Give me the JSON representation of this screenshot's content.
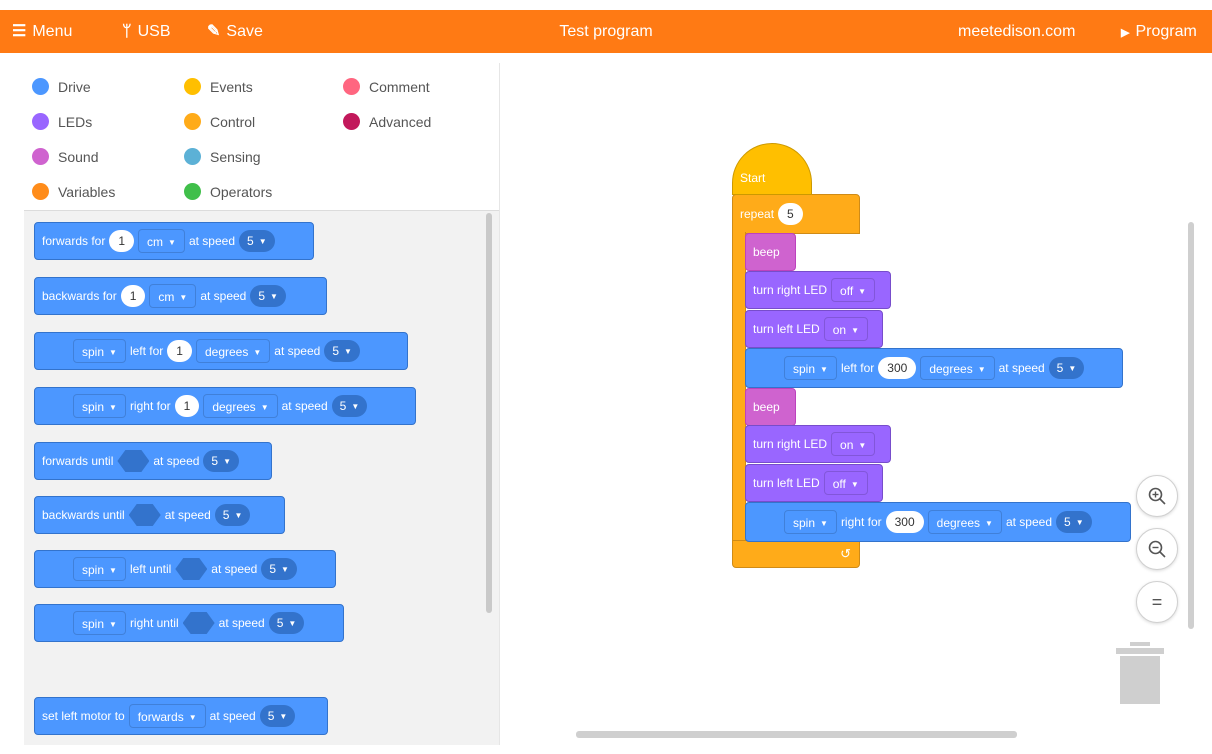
{
  "topbar": {
    "menu": "Menu",
    "usb": "USB",
    "save": "Save",
    "title": "Test program",
    "site": "meetedison.com",
    "program": "Program",
    "color": "#FF7A14"
  },
  "categories": [
    {
      "label": "Drive",
      "color": "#4C97FF"
    },
    {
      "label": "Events",
      "color": "#FFBF00"
    },
    {
      "label": "Comment",
      "color": "#FF6680"
    },
    {
      "label": "LEDs",
      "color": "#9966FF"
    },
    {
      "label": "Control",
      "color": "#FFAB19"
    },
    {
      "label": "Advanced",
      "color": "#C2185B"
    },
    {
      "label": "Sound",
      "color": "#CF63CF"
    },
    {
      "label": "Sensing",
      "color": "#5CB1D6"
    },
    {
      "label": "Variables",
      "color": "#FF8C1A"
    },
    {
      "label": "Operators",
      "color": "#40BF4A"
    }
  ],
  "palette": {
    "b1": {
      "a": "forwards for",
      "v": "1",
      "unit": "cm",
      "b": "at speed",
      "speed": "5"
    },
    "b2": {
      "a": "backwards for",
      "v": "1",
      "unit": "cm",
      "b": "at speed",
      "speed": "5"
    },
    "b3": {
      "mode": "spin",
      "a": "left for",
      "v": "1",
      "unit": "degrees",
      "b": "at speed",
      "speed": "5"
    },
    "b4": {
      "mode": "spin",
      "a": "right for",
      "v": "1",
      "unit": "degrees",
      "b": "at speed",
      "speed": "5"
    },
    "b5": {
      "a": "forwards until",
      "b": "at speed",
      "speed": "5"
    },
    "b6": {
      "a": "backwards until",
      "b": "at speed",
      "speed": "5"
    },
    "b7": {
      "mode": "spin",
      "a": "left until",
      "b": "at speed",
      "speed": "5"
    },
    "b8": {
      "mode": "spin",
      "a": "right until",
      "b": "at speed",
      "speed": "5"
    },
    "b9": {
      "a": "set left motor to",
      "dir": "forwards",
      "b": "at speed",
      "speed": "5"
    }
  },
  "program": {
    "start": "Start",
    "repeat": {
      "label": "repeat",
      "count": "5"
    },
    "beep1": "beep",
    "led1": {
      "label": "turn right LED",
      "state": "off"
    },
    "led2": {
      "label": "turn left LED",
      "state": "on"
    },
    "spin1": {
      "mode": "spin",
      "a": "left for",
      "v": "300",
      "unit": "degrees",
      "b": "at speed",
      "speed": "5"
    },
    "beep2": "beep",
    "led3": {
      "label": "turn right LED",
      "state": "on"
    },
    "led4": {
      "label": "turn left LED",
      "state": "off"
    },
    "spin2": {
      "mode": "spin",
      "a": "right for",
      "v": "300",
      "unit": "degrees",
      "b": "at speed",
      "speed": "5"
    }
  },
  "zoom": {
    "in": "+",
    "out": "−",
    "reset": "="
  }
}
